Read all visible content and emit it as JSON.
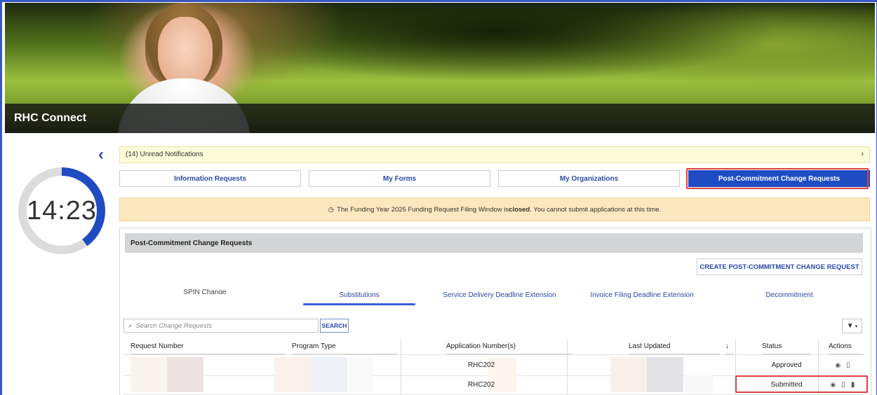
{
  "app": {
    "title": "RHC Connect"
  },
  "timer": {
    "value": "14:23",
    "remaining_fraction": 0.4
  },
  "notifications": {
    "label": "(14) Unread Notifications"
  },
  "nav": [
    {
      "label": "Information Requests"
    },
    {
      "label": "My Forms"
    },
    {
      "label": "My Organizations"
    },
    {
      "label": "Post-Commitment Change Requests"
    }
  ],
  "alert": {
    "prefix": "The Funding Year 2025 Funding Request Filing Window is ",
    "emph": "closed",
    "suffix": ". You cannot submit applications at this time."
  },
  "panel": {
    "title": "Post-Commitment Change Requests",
    "create_label": "CREATE POST-COMMITMENT CHANGE REQUEST",
    "tabs": [
      {
        "label": "SPIN Change"
      },
      {
        "label": "Substitutions"
      },
      {
        "label": "Service Delivery Deadline Extension"
      },
      {
        "label": "Invoice Filing Deadline Extension"
      },
      {
        "label": "Decommitment"
      }
    ]
  },
  "search": {
    "placeholder": "Search Change Requests",
    "button_label": "SEARCH"
  },
  "table": {
    "columns": [
      "Request Number",
      "Program Type",
      "Application Number(s)",
      "Last Updated",
      "Status",
      "Actions"
    ],
    "sort_indicator": "↓",
    "rows": [
      {
        "application": "RHC202",
        "status": "Approved"
      },
      {
        "application": "RHC202",
        "status": "Submitted"
      }
    ]
  },
  "colors": {
    "accent": "#1f4cc2",
    "highlight": "#e04040",
    "alert_bg": "#fce8bf",
    "notif_bg": "#fdfcd9"
  }
}
